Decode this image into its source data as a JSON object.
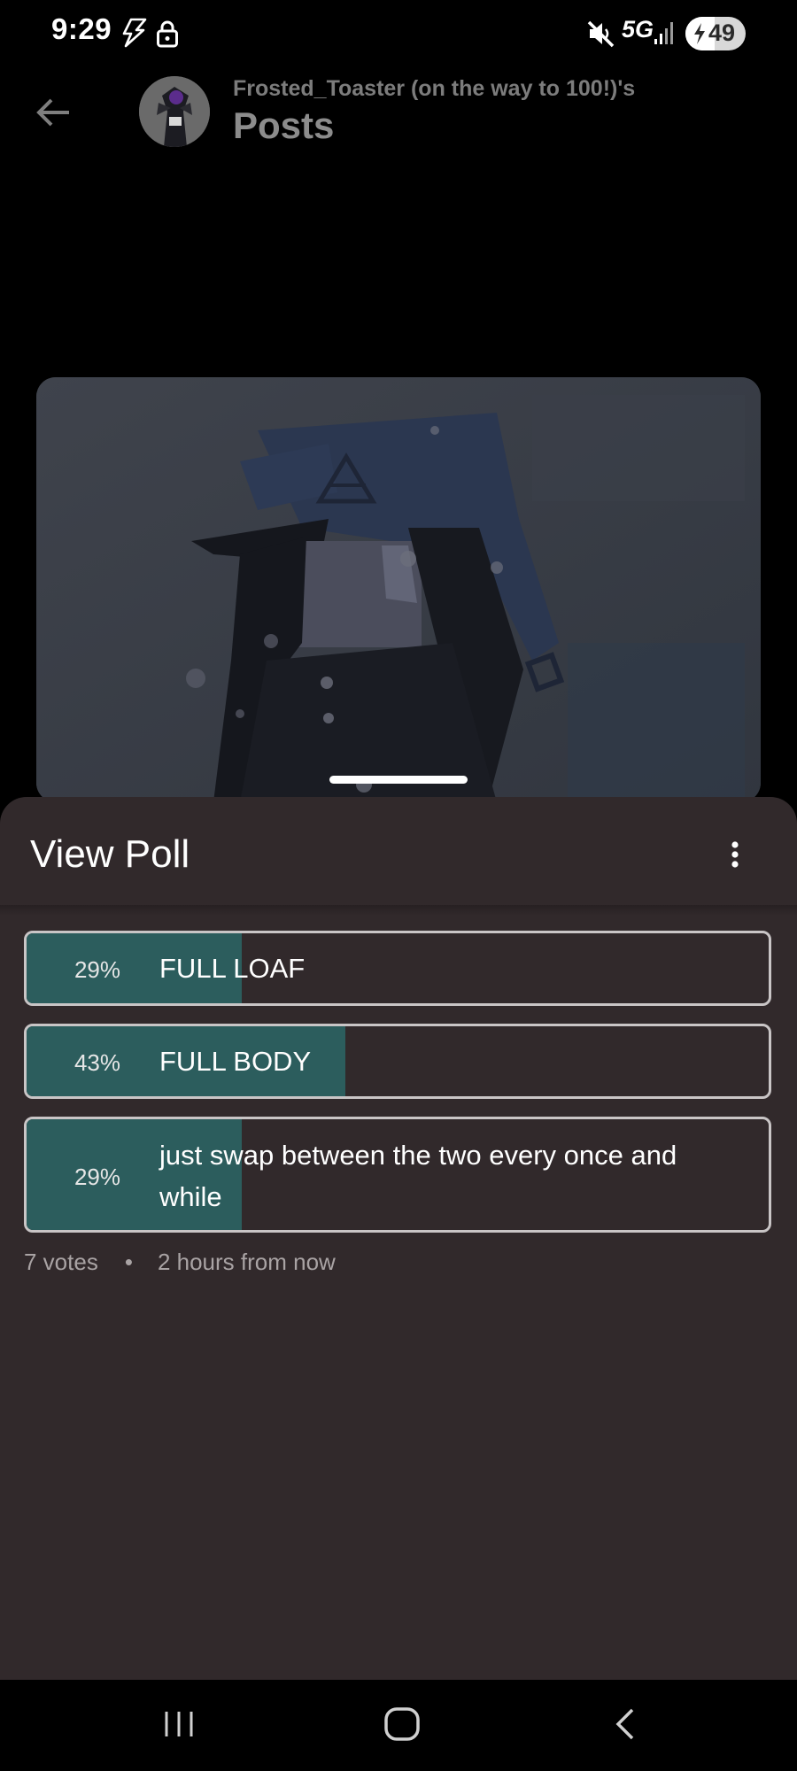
{
  "status_bar": {
    "time": "9:29",
    "network": "5G",
    "battery_level": "49",
    "battery_fraction": 0.49,
    "icons": [
      "charging-bolt-icon",
      "lock-icon",
      "mute-icon",
      "signal-icon",
      "battery-icon"
    ]
  },
  "header": {
    "subtitle": "Frosted_Toaster (on the way to 100!)'s",
    "title": "Posts",
    "back_icon": "arrow-left-icon"
  },
  "sheet": {
    "title": "View Poll",
    "menu_icon": "more-vertical-icon",
    "options": [
      {
        "percent_label": "29%",
        "percent": 0.29,
        "label": "FULL LOAF"
      },
      {
        "percent_label": "43%",
        "percent": 0.43,
        "label": "FULL BODY"
      },
      {
        "percent_label": "29%",
        "percent": 0.29,
        "label": "just swap between the two every once and while"
      }
    ],
    "votes": "7 votes",
    "separator": "•",
    "time_left": "2 hours from now"
  },
  "nav_bar": {
    "icons": [
      "recent-apps-icon",
      "home-icon",
      "back-icon"
    ]
  },
  "colors": {
    "sheet_bg": "#31292b",
    "poll_fill": "#2c5d5d",
    "poll_border": "#c9c5c6"
  }
}
